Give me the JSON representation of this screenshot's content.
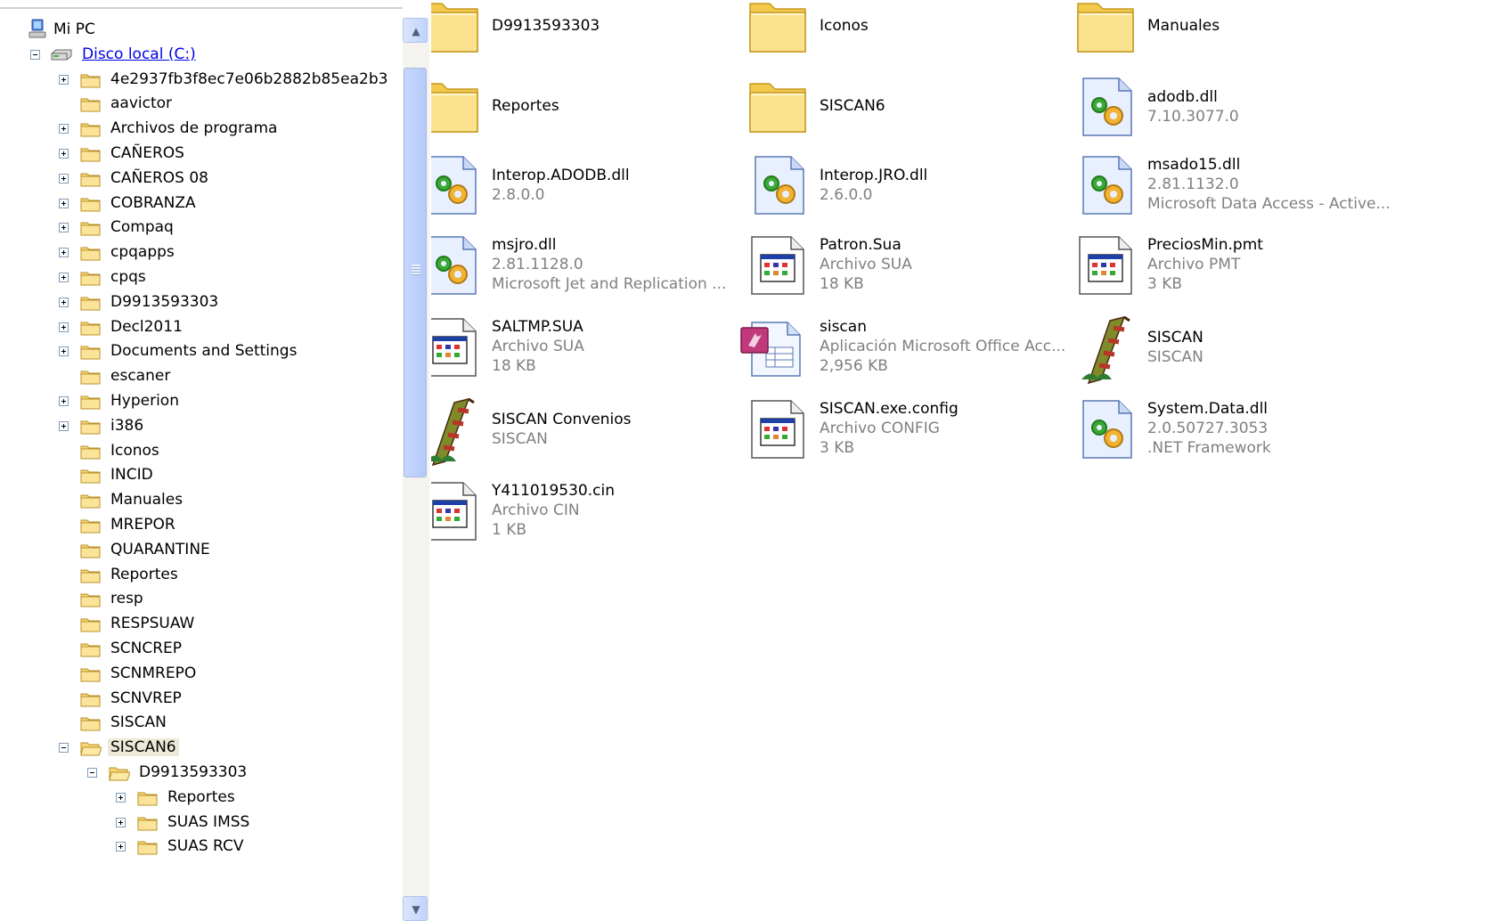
{
  "tree": {
    "items": [
      {
        "label": "Mi PC",
        "type": "computer",
        "exp": "none"
      },
      {
        "label": "Disco local (C:)",
        "type": "drive",
        "exp": "minus",
        "link": true
      },
      {
        "label": "4e2937fb3f8ec7e06b2882b85ea2b3",
        "type": "folder",
        "exp": "plus"
      },
      {
        "label": "aavictor",
        "type": "folder",
        "exp": "none"
      },
      {
        "label": "Archivos de programa",
        "type": "folder",
        "exp": "plus"
      },
      {
        "label": "CAÑEROS",
        "type": "folder",
        "exp": "plus"
      },
      {
        "label": "CAÑEROS 08",
        "type": "folder",
        "exp": "plus"
      },
      {
        "label": "COBRANZA",
        "type": "folder",
        "exp": "plus"
      },
      {
        "label": "Compaq",
        "type": "folder",
        "exp": "plus"
      },
      {
        "label": "cpqapps",
        "type": "folder",
        "exp": "plus"
      },
      {
        "label": "cpqs",
        "type": "folder",
        "exp": "plus"
      },
      {
        "label": "D9913593303",
        "type": "folder",
        "exp": "plus"
      },
      {
        "label": "Decl2011",
        "type": "folder",
        "exp": "plus"
      },
      {
        "label": "Documents and Settings",
        "type": "folder",
        "exp": "plus"
      },
      {
        "label": "escaner",
        "type": "folder",
        "exp": "none"
      },
      {
        "label": "Hyperion",
        "type": "folder",
        "exp": "plus"
      },
      {
        "label": "i386",
        "type": "folder",
        "exp": "plus"
      },
      {
        "label": "Iconos",
        "type": "folder",
        "exp": "none"
      },
      {
        "label": "INCID",
        "type": "folder",
        "exp": "none"
      },
      {
        "label": "Manuales",
        "type": "folder",
        "exp": "none"
      },
      {
        "label": "MREPOR",
        "type": "folder",
        "exp": "none"
      },
      {
        "label": "QUARANTINE",
        "type": "folder",
        "exp": "none"
      },
      {
        "label": "Reportes",
        "type": "folder",
        "exp": "none"
      },
      {
        "label": "resp",
        "type": "folder",
        "exp": "none"
      },
      {
        "label": "RESPSUAW",
        "type": "folder",
        "exp": "none"
      },
      {
        "label": "SCNCREP",
        "type": "folder",
        "exp": "none"
      },
      {
        "label": "SCNMREPO",
        "type": "folder",
        "exp": "none"
      },
      {
        "label": "SCNVREP",
        "type": "folder",
        "exp": "none"
      },
      {
        "label": "SISCAN",
        "type": "folder",
        "exp": "none"
      },
      {
        "label": "SISCAN6",
        "type": "folder-open",
        "exp": "minus",
        "selected": true
      },
      {
        "label": "D9913593303",
        "type": "folder-open",
        "exp": "minus"
      },
      {
        "label": "Reportes",
        "type": "folder",
        "exp": "plus"
      },
      {
        "label": "SUAS IMSS",
        "type": "folder",
        "exp": "plus"
      },
      {
        "label": "SUAS RCV",
        "type": "folder",
        "exp": "plus"
      }
    ]
  },
  "files": [
    {
      "name": "D9913593303",
      "sub1": "",
      "sub2": "",
      "icon": "folder-icon"
    },
    {
      "name": "Iconos",
      "sub1": "",
      "sub2": "",
      "icon": "folder-icon"
    },
    {
      "name": "Manuales",
      "sub1": "",
      "sub2": "",
      "icon": "folder-icon"
    },
    {
      "name": "Reportes",
      "sub1": "",
      "sub2": "",
      "icon": "folder-icon"
    },
    {
      "name": "SISCAN6",
      "sub1": "",
      "sub2": "",
      "icon": "folder-icon"
    },
    {
      "name": "adodb.dll",
      "sub1": "7.10.3077.0",
      "sub2": "",
      "icon": "dll-icon"
    },
    {
      "name": "Interop.ADODB.dll",
      "sub1": "2.8.0.0",
      "sub2": "",
      "icon": "dll-icon"
    },
    {
      "name": "Interop.JRO.dll",
      "sub1": "2.6.0.0",
      "sub2": "",
      "icon": "dll-icon"
    },
    {
      "name": "msado15.dll",
      "sub1": "2.81.1132.0",
      "sub2": "Microsoft Data Access - Active...",
      "icon": "dll-icon"
    },
    {
      "name": "msjro.dll",
      "sub1": "2.81.1128.0",
      "sub2": "Microsoft Jet and Replication ...",
      "icon": "dll-icon"
    },
    {
      "name": "Patron.Sua",
      "sub1": "Archivo SUA",
      "sub2": "18 KB",
      "icon": "generic-file-icon"
    },
    {
      "name": "PreciosMin.pmt",
      "sub1": "Archivo PMT",
      "sub2": "3 KB",
      "icon": "generic-file-icon"
    },
    {
      "name": "SALTMP.SUA",
      "sub1": "Archivo SUA",
      "sub2": "18 KB",
      "icon": "generic-file-icon"
    },
    {
      "name": "siscan",
      "sub1": "Aplicación Microsoft Office Acc...",
      "sub2": "2,956 KB",
      "icon": "access-db-icon"
    },
    {
      "name": "SISCAN",
      "sub1": "SISCAN",
      "sub2": "",
      "icon": "siscan-app-icon"
    },
    {
      "name": "SISCAN Convenios",
      "sub1": "SISCAN",
      "sub2": "",
      "icon": "siscan-app-icon"
    },
    {
      "name": "SISCAN.exe.config",
      "sub1": "Archivo CONFIG",
      "sub2": "3 KB",
      "icon": "generic-file-icon"
    },
    {
      "name": "System.Data.dll",
      "sub1": "2.0.50727.3053",
      "sub2": ".NET Framework",
      "icon": "dll-icon"
    },
    {
      "name": "Y411019530.cin",
      "sub1": "Archivo CIN",
      "sub2": "1 KB",
      "icon": "generic-file-icon"
    }
  ],
  "scrollbar": {
    "up_glyph": "▲",
    "down_glyph": "▼"
  }
}
